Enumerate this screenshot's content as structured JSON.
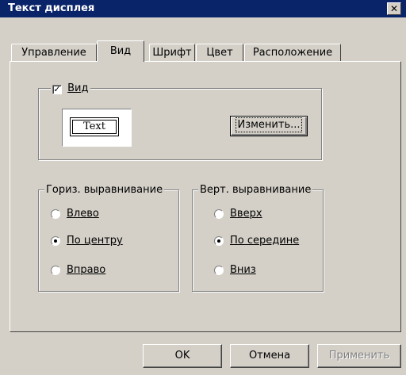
{
  "window": {
    "title": "Текст дисплея",
    "close_glyph": "✕"
  },
  "tabs": [
    {
      "label": "Управление"
    },
    {
      "label": "Вид"
    },
    {
      "label": "Шрифт"
    },
    {
      "label": "Цвет"
    },
    {
      "label": "Расположение"
    }
  ],
  "view_group": {
    "checkbox_checked": true,
    "checkbox_label": "Вид",
    "preview_text": "Text",
    "change_button": "Изменить..."
  },
  "horizontal_align": {
    "title": "Гориз. выравнивание",
    "options": [
      {
        "label": "Влево",
        "checked": false
      },
      {
        "label": "По центру",
        "checked": true
      },
      {
        "label": "Вправо",
        "checked": false
      }
    ]
  },
  "vertical_align": {
    "title": "Верт. выравнивание",
    "options": [
      {
        "label": "Вверх",
        "checked": false
      },
      {
        "label": "По середине",
        "checked": true
      },
      {
        "label": "Вниз",
        "checked": false
      }
    ]
  },
  "buttons": {
    "ok": "OK",
    "cancel": "Отмена",
    "apply": "Применить"
  },
  "colors": {
    "titlebar": "#0a246a",
    "face": "#d4d0c8"
  }
}
